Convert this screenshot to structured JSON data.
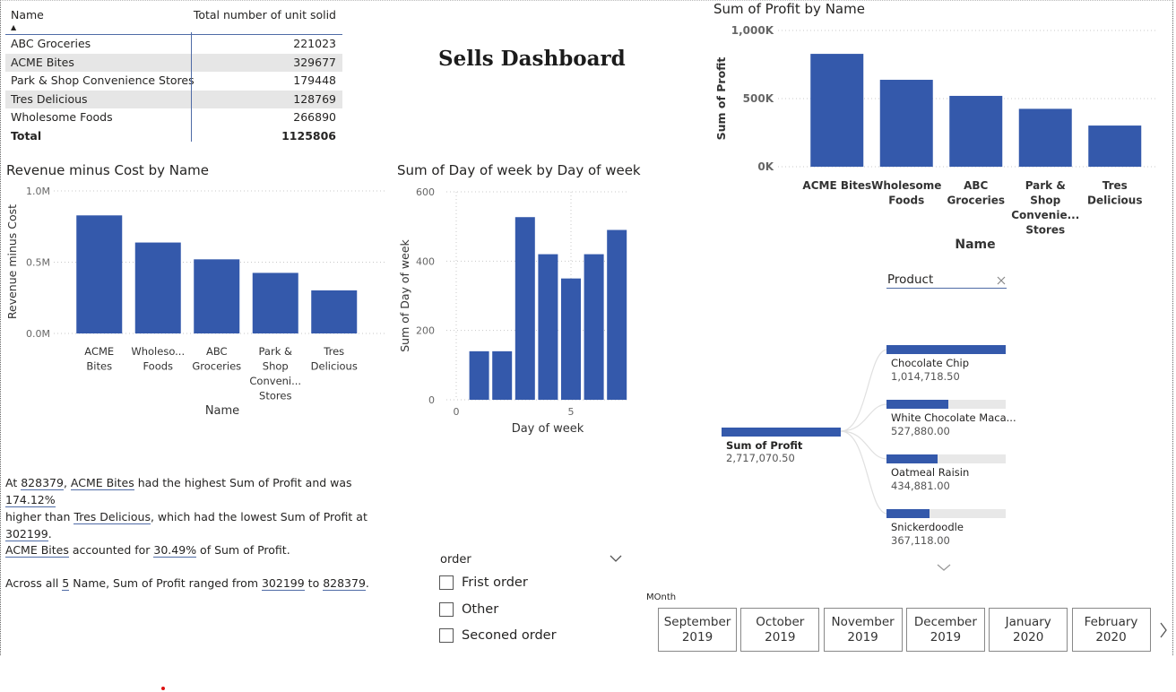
{
  "dashboard_title": "Sells Dashboard",
  "table": {
    "col_name": "Name",
    "col_value": "Total number of unit solid",
    "sort_indicator": "▲",
    "rows": [
      {
        "name": "ABC Groceries",
        "value": "221023"
      },
      {
        "name": "ACME Bites",
        "value": "329677"
      },
      {
        "name": "Park & Shop Convenience Stores",
        "value": "179448"
      },
      {
        "name": "Tres Delicious",
        "value": "128769"
      },
      {
        "name": "Wholesome Foods",
        "value": "266890"
      }
    ],
    "total_label": "Total",
    "total_value": "1125806"
  },
  "chart_data": [
    {
      "id": "revenue-minus-cost",
      "type": "bar",
      "title": "Revenue minus Cost by Name",
      "xlabel": "Name",
      "ylabel": "Revenue minus Cost",
      "categories": [
        [
          "ACME",
          "Bites"
        ],
        [
          "Wholeso...",
          "Foods"
        ],
        [
          "ABC",
          "Groceries"
        ],
        [
          "Park &",
          "Shop",
          "Conveni...",
          "Stores"
        ],
        [
          "Tres",
          "Delicious"
        ]
      ],
      "values": [
        828379,
        638000,
        520000,
        425000,
        302199
      ],
      "yticks": [
        {
          "v": 0,
          "label": "0.0M"
        },
        {
          "v": 500000,
          "label": "0.5M"
        },
        {
          "v": 1000000,
          "label": "1.0M"
        }
      ],
      "ylim": [
        0,
        1000000
      ],
      "color": "#3459ab"
    },
    {
      "id": "day-of-week",
      "type": "bar",
      "title": "Sum of Day of week by Day of week",
      "xlabel": "Day of week",
      "ylabel": "Sum of Day of week",
      "x": [
        1,
        2,
        3,
        4,
        5,
        6,
        7
      ],
      "values": [
        140,
        140,
        527,
        420,
        350,
        420,
        490
      ],
      "xticks": [
        {
          "v": 0,
          "label": "0"
        },
        {
          "v": 5,
          "label": "5"
        }
      ],
      "yticks": [
        {
          "v": 0,
          "label": "0"
        },
        {
          "v": 200,
          "label": "200"
        },
        {
          "v": 400,
          "label": "400"
        },
        {
          "v": 600,
          "label": "600"
        }
      ],
      "ylim": [
        0,
        600
      ],
      "color": "#3459ab"
    },
    {
      "id": "profit-by-name",
      "type": "bar",
      "title": "Sum of Profit by Name",
      "xlabel": "Name",
      "ylabel": "Sum of Profit",
      "categories": [
        [
          "ACME Bites"
        ],
        [
          "Wholesome",
          "Foods"
        ],
        [
          "ABC",
          "Groceries"
        ],
        [
          "Park &",
          "Shop",
          "Convenie...",
          "Stores"
        ],
        [
          "Tres",
          "Delicious"
        ]
      ],
      "values": [
        828379,
        638000,
        520000,
        425000,
        302199
      ],
      "yticks": [
        {
          "v": 0,
          "label": "0K"
        },
        {
          "v": 500000,
          "label": "500K"
        },
        {
          "v": 1000000,
          "label": "1,000K"
        }
      ],
      "ylim": [
        0,
        1000000
      ],
      "color": "#3459ab"
    }
  ],
  "narrative": {
    "p1_a": "At ",
    "p1_v1": "828379",
    "p1_b": ", ",
    "p1_n1": "ACME Bites",
    "p1_c": " had the highest Sum of Profit and was ",
    "p1_v2": "174.12%",
    "p1_d": "higher than ",
    "p1_n2": "Tres Delicious",
    "p1_e": ", which had the lowest Sum of Profit at",
    "p1_v3": "302199",
    "p1_f": ".",
    "p2_n": "ACME Bites",
    "p2_a": " accounted for ",
    "p2_v": "30.49%",
    "p2_b": " of Sum of Profit.",
    "p3_a": "Across all ",
    "p3_v1": "5",
    "p3_b": " Name, Sum of Profit ranged from ",
    "p3_v2": "302199",
    "p3_c": " to ",
    "p3_v3": "828379",
    "p3_d": "."
  },
  "order_slicer": {
    "title": "order",
    "options": [
      "Frist order",
      "Other",
      "Seconed order"
    ]
  },
  "month_slicer": {
    "label": "MOnth",
    "months": [
      {
        "m": "September",
        "y": "2019"
      },
      {
        "m": "October",
        "y": "2019"
      },
      {
        "m": "November",
        "y": "2019"
      },
      {
        "m": "December",
        "y": "2019"
      },
      {
        "m": "January",
        "y": "2020"
      },
      {
        "m": "February",
        "y": "2020"
      }
    ]
  },
  "decomposition": {
    "field": "Product",
    "root_label": "Sum of Profit",
    "root_value": "2,717,070.50",
    "items": [
      {
        "label": "Chocolate Chip",
        "value": "1,014,718.50",
        "fraction": 1.0
      },
      {
        "label": "White Chocolate Maca...",
        "value": "527,880.00",
        "fraction": 0.52
      },
      {
        "label": "Oatmeal Raisin",
        "value": "434,881.00",
        "fraction": 0.43
      },
      {
        "label": "Snickerdoodle",
        "value": "367,118.00",
        "fraction": 0.36
      }
    ]
  }
}
